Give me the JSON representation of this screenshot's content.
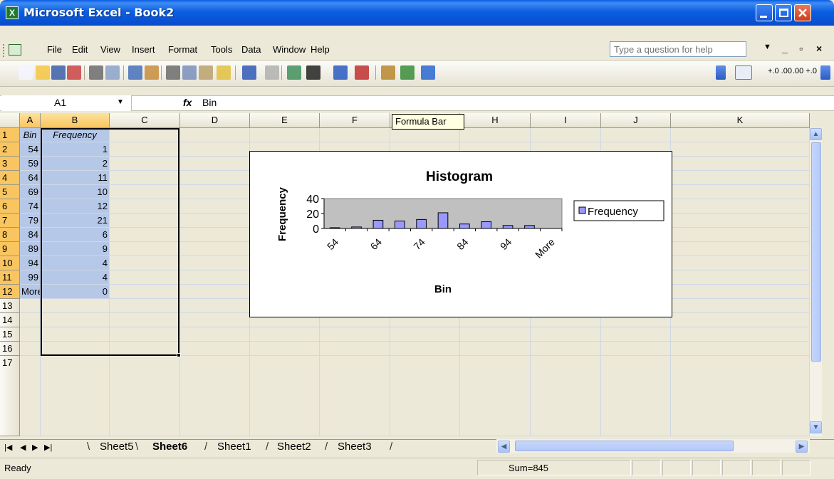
{
  "window": {
    "title": "Microsoft Excel - Book2",
    "app_icon_letter": "X"
  },
  "menu": {
    "items": [
      "File",
      "Edit",
      "View",
      "Insert",
      "Format",
      "Tools",
      "Data",
      "Window",
      "Help"
    ],
    "help_placeholder": "Type a question for help"
  },
  "toolbar": {
    "icons": [
      "new-icon",
      "open-icon",
      "save-icon",
      "permission-icon",
      "print-icon",
      "print-preview-icon",
      "spelling-icon",
      "research-icon",
      "cut-icon",
      "copy-icon",
      "paste-icon",
      "format-painter-icon",
      "undo-icon",
      "redo-icon",
      "hyperlink-icon",
      "autosum-icon",
      "sort-ascending-icon",
      "sort-descending-icon",
      "chart-wizard-icon",
      "drawing-icon",
      "help-icon"
    ],
    "decimal_increase_label": "+.0 .00",
    "decimal_decrease_label": ".00 +.0"
  },
  "formula_bar": {
    "name_box": "A1",
    "fx_label": "fx",
    "content": "Bin",
    "tooltip": "Formula Bar"
  },
  "grid": {
    "columns": [
      "A",
      "B",
      "C",
      "D",
      "E",
      "F",
      "G",
      "H",
      "I",
      "J",
      "K"
    ],
    "rows": [
      "1",
      "2",
      "3",
      "4",
      "5",
      "6",
      "7",
      "8",
      "9",
      "10",
      "11",
      "12",
      "13",
      "14",
      "15",
      "16",
      "17"
    ],
    "header_row": [
      "Bin",
      "Frequency"
    ],
    "data": [
      [
        "54",
        "1"
      ],
      [
        "59",
        "2"
      ],
      [
        "64",
        "11"
      ],
      [
        "69",
        "10"
      ],
      [
        "74",
        "12"
      ],
      [
        "79",
        "21"
      ],
      [
        "84",
        "6"
      ],
      [
        "89",
        "9"
      ],
      [
        "94",
        "4"
      ],
      [
        "99",
        "4"
      ],
      [
        "More",
        "0"
      ]
    ]
  },
  "chart_data": {
    "type": "bar",
    "title": "Histogram",
    "xlabel": "Bin",
    "ylabel": "Frequency",
    "categories": [
      "54",
      "59",
      "64",
      "69",
      "74",
      "79",
      "84",
      "89",
      "94",
      "99",
      "More"
    ],
    "shown_tick_labels": [
      "54",
      "64",
      "74",
      "84",
      "94",
      "More"
    ],
    "y_ticks": [
      "40",
      "20",
      "0"
    ],
    "ylim": [
      0,
      40
    ],
    "series": [
      {
        "name": "Frequency",
        "values": [
          1,
          2,
          11,
          10,
          12,
          21,
          6,
          9,
          4,
          4,
          0
        ],
        "color": "#9999ff"
      }
    ],
    "plot_area_color": "#c0c0c0",
    "legend_position": "right"
  },
  "sheets": {
    "tabs": [
      "Sheet5",
      "Sheet6",
      "Sheet1",
      "Sheet2",
      "Sheet3"
    ],
    "active": "Sheet6"
  },
  "status": {
    "mode": "Ready",
    "sum": "Sum=845"
  }
}
